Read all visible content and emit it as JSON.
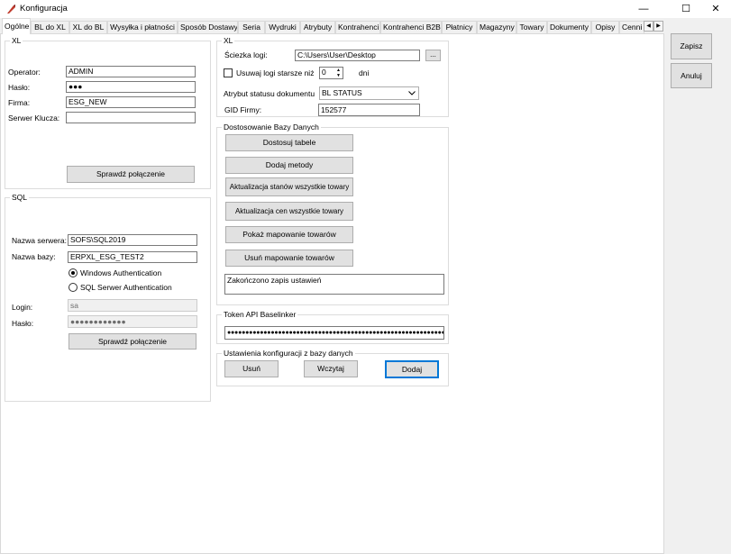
{
  "window": {
    "title": "Konfiguracja",
    "minimize": "—",
    "maximize": "☐",
    "close": "✕"
  },
  "tabs": [
    "Ogólne",
    "BL do XL",
    "XL do BL",
    "Wysyłka i płatności",
    "Sposób Dostawy",
    "Seria",
    "Wydruki",
    "Atrybuty",
    "Kontrahenci",
    "Kontrahenci B2B",
    "Płatnicy",
    "Magazyny",
    "Towary",
    "Dokumenty",
    "Opisy",
    "Cenni"
  ],
  "tab_scroll": {
    "left": "◀",
    "right": "▶"
  },
  "side_buttons": {
    "save": "Zapisz",
    "cancel": "Anuluj"
  },
  "xl_login": {
    "title": "XL",
    "operator_label": "Operator:",
    "operator_value": "ADMIN",
    "password_label": "Hasło:",
    "password_value": "●●●",
    "company_label": "Firma:",
    "company_value": "ESG_NEW",
    "key_server_label": "Serwer Klucza:",
    "key_server_value": "",
    "test_button": "Sprawdź połączenie"
  },
  "sql": {
    "title": "SQL",
    "server_label": "Nazwa serwera:",
    "server_value": "SOFS\\SQL2019",
    "db_label": "Nazwa bazy:",
    "db_value": "ERPXL_ESG_TEST2",
    "auth_windows": "Windows Authentication",
    "auth_sql": "SQL Serwer Authentication",
    "login_label": "Login:",
    "login_value": "sa",
    "password_label": "Hasło:",
    "password_value": "●●●●●●●●●●●●",
    "test_button": "Sprawdź połączenie"
  },
  "xl_settings": {
    "title": "XL",
    "log_path_label": "Ściezka logi:",
    "log_path_value": "C:\\Users\\User\\Desktop",
    "browse_button": "...",
    "delete_logs_label": "Usuwaj logi starsze niż",
    "delete_logs_value": "0",
    "days_label": "dni",
    "status_attr_label": "Atrybut statusu dokumentu",
    "status_attr_value": "BL STATUS",
    "gid_label": "GID Firmy:",
    "gid_value": "152577"
  },
  "db_adjust": {
    "title": "Dostosowanie Bazy Danych",
    "buttons": [
      "Dostosuj tabele",
      "Dodaj metody",
      "Aktualizacja stanów wszystkie towary",
      "Aktualizacja cen wszystkie towary",
      "Pokaż mapowanie towarów",
      "Usuń mapowanie towarów"
    ],
    "status_message": "Zakończono zapis ustawień"
  },
  "token": {
    "title": "Token API Baselinker",
    "value": "●●●●●●●●●●●●●●●●●●●●●●●●●●●●●●●●●●●●●●●●●●●●●●●●●●●●●●●●●●●●●●"
  },
  "config_db": {
    "title": "Ustawienia konfiguracji z bazy danych",
    "delete": "Usuń",
    "load": "Wczytaj",
    "add": "Dodaj"
  },
  "colors": {
    "accent": "#0078d7",
    "button_face": "#e1e1e1",
    "border": "#adadad"
  }
}
